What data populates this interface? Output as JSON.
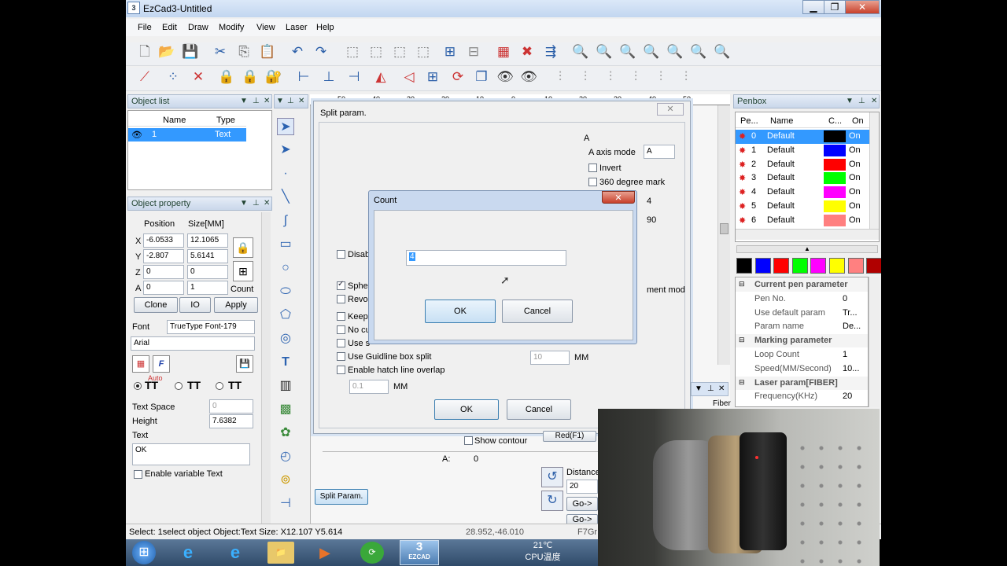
{
  "window": {
    "title": "EzCad3-Untitled",
    "logo": "3",
    "min": "▁",
    "max": "❐",
    "close": "✕"
  },
  "menu": [
    "File",
    "Edit",
    "Draw",
    "Modify",
    "View",
    "Laser",
    "Help"
  ],
  "object_list": {
    "title": "Object list",
    "headers": [
      "",
      "Name",
      "Type"
    ],
    "row": {
      "name": "1",
      "type": "Text"
    }
  },
  "object_property": {
    "title": "Object property",
    "position_label": "Position",
    "size_label": "Size[MM]",
    "x_label": "X",
    "x": "-6.0533",
    "w": "12.1065",
    "y_label": "Y",
    "y": "-2.807",
    "h": "5.6141",
    "z_label": "Z",
    "z": "0",
    "z2": "0",
    "a_label": "A",
    "a": "0",
    "a2": "1",
    "count_label": "Count",
    "clone": "Clone",
    "io": "IO",
    "apply": "Apply",
    "font_label": "Font",
    "font_type": "TrueType Font-179",
    "font_name": "Arial",
    "auto_label": "Auto",
    "text_space_label": "Text Space",
    "text_space": "0",
    "height_label": "Height",
    "height": "7.6382",
    "text_label": "Text",
    "text": "OK",
    "variable_text": "Enable variable Text"
  },
  "ruler": [
    "-50",
    "-40",
    "-30",
    "-20",
    "-10",
    "0",
    "10",
    "20",
    "30",
    "40",
    "50"
  ],
  "split_dialog": {
    "title": "Split param.",
    "close": "✕",
    "a_header": "A",
    "a_axis_mode_label": "A axis mode",
    "a_axis_mode": "A",
    "invert": "Invert",
    "mark360": "360 degree mark",
    "val4": "4",
    "val90": "90",
    "disable": "Disab",
    "sphere": "Spher",
    "revol": "Revol",
    "keep": "Keep",
    "no_cu": "No cu",
    "use_s": "Use s",
    "guideline": "Use Guidline box split",
    "hatch_overlap": "Enable hatch line overlap",
    "hatch_value": "0.1",
    "mm": "MM",
    "guide_value": "10",
    "mm2": "MM",
    "ment_mod": "ment mod",
    "ok": "OK",
    "cancel": "Cancel"
  },
  "count_dialog": {
    "title": "Count",
    "close": "✕",
    "value": "4",
    "ok": "OK",
    "cancel": "Cancel"
  },
  "below_canvas": {
    "show_contour": "Show contour",
    "red_btn": "Red(F1)",
    "a_label": "A:",
    "a_value": "0",
    "split_param_btn": "Split Param.",
    "distance_label": "Distance",
    "distance": "20",
    "go1": "Go->",
    "go2": "Go->"
  },
  "penbox": {
    "title": "Penbox",
    "headers": [
      "Pe...",
      "Name",
      "C...",
      "On"
    ],
    "pens": [
      {
        "no": "0",
        "name": "Default",
        "color": "#000000",
        "on": "On"
      },
      {
        "no": "1",
        "name": "Default",
        "color": "#0000ff",
        "on": "On"
      },
      {
        "no": "2",
        "name": "Default",
        "color": "#ff0000",
        "on": "On"
      },
      {
        "no": "3",
        "name": "Default",
        "color": "#00ff00",
        "on": "On"
      },
      {
        "no": "4",
        "name": "Default",
        "color": "#ff00ff",
        "on": "On"
      },
      {
        "no": "5",
        "name": "Default",
        "color": "#ffff00",
        "on": "On"
      },
      {
        "no": "6",
        "name": "Default",
        "color": "#ff7f7f",
        "on": "On"
      }
    ],
    "swatches": [
      "#000000",
      "#0000ff",
      "#ff0000",
      "#00ff00",
      "#ff00ff",
      "#ffff00",
      "#ff8080",
      "#b00000"
    ],
    "params": [
      {
        "k": "Current pen parameter",
        "v": "",
        "group": true
      },
      {
        "k": "Pen No.",
        "v": "0"
      },
      {
        "k": "Use default param",
        "v": "Tr..."
      },
      {
        "k": "Param name",
        "v": "De..."
      },
      {
        "k": "Marking parameter",
        "v": "",
        "group": true
      },
      {
        "k": "Loop Count",
        "v": "1"
      },
      {
        "k": "Speed(MM/Second)",
        "v": "10..."
      },
      {
        "k": "Laser param[FIBER]",
        "v": "",
        "group": true
      },
      {
        "k": "Frequency(KHz)",
        "v": "20"
      }
    ],
    "fiber_tab": "Fiber"
  },
  "status": {
    "text": "Select: 1select object Object:Text Size: X12.107 Y5.614",
    "coords": "28.952,-46.010",
    "f7": "F7Gr"
  },
  "taskbar": {
    "temp": "21℃",
    "cpu": "CPU温度",
    "ezcad": "EZCAD"
  }
}
